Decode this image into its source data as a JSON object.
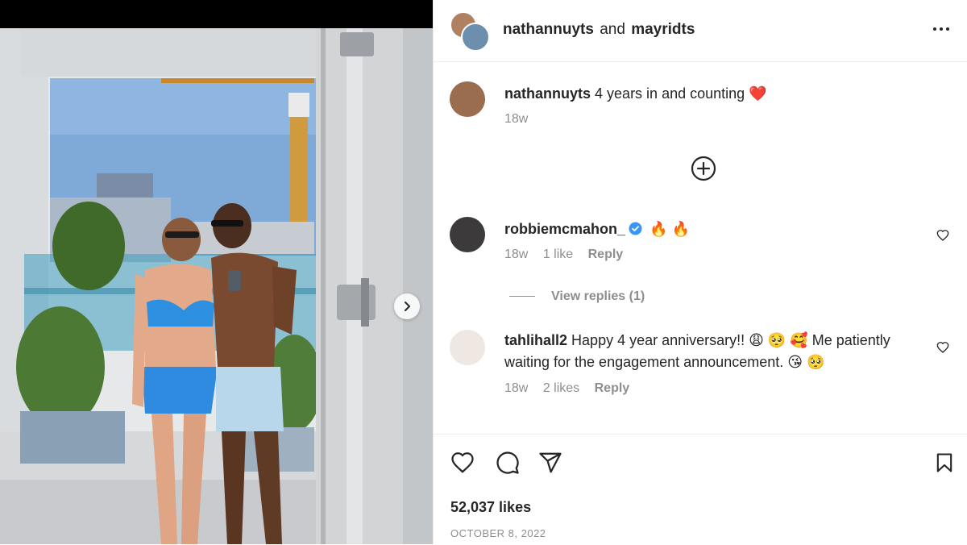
{
  "post": {
    "author1": "nathannuyts",
    "conjunction": "and",
    "author2": "mayridts",
    "likes": "52,037 likes",
    "date": "OCTOBER 8, 2022"
  },
  "caption": {
    "user": "nathannuyts",
    "text": "4 years in and counting",
    "emoji": "❤️",
    "time": "18w"
  },
  "comments": [
    {
      "user": "robbiemcmahon_",
      "verified": true,
      "text": "🔥 🔥",
      "time": "18w",
      "likes": "1 like",
      "reply": "Reply",
      "view_replies": "View replies (1)"
    },
    {
      "user": "tahlihall2",
      "verified": false,
      "text": "Happy 4 year anniversary!! 😩 🥺 🥰 Me patiently waiting for the engagement announcement. 😘 🥺",
      "time": "18w",
      "likes": "2 likes",
      "reply": "Reply"
    }
  ],
  "icons": {
    "like": "heart-icon",
    "comment": "comment-icon",
    "share": "paper-plane-icon",
    "save": "bookmark-icon",
    "more": "ellipsis-icon",
    "next": "chevron-right-icon",
    "add": "plus-circle-icon",
    "verified": "verified-badge-icon"
  },
  "colors": {
    "verified": "#3897f0",
    "text": "#262626",
    "muted": "#8e8e8e",
    "heart": "#ed4956"
  }
}
